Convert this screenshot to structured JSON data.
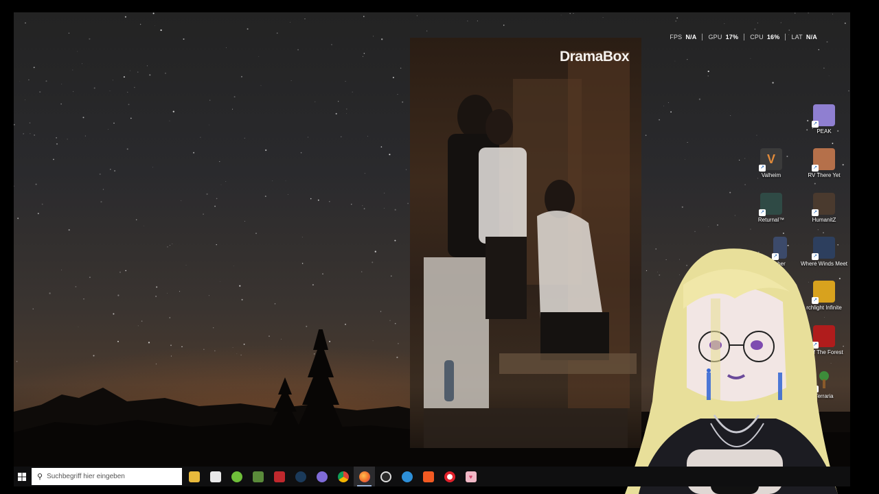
{
  "perf_overlay": {
    "items": [
      {
        "key": "FPS",
        "value": "N/A"
      },
      {
        "key": "GPU",
        "value": "17%"
      },
      {
        "key": "CPU",
        "value": "16%"
      },
      {
        "key": "LAT",
        "value": "N/A"
      }
    ]
  },
  "video_player": {
    "brand": "DramaBox"
  },
  "desktop_icons": [
    {
      "label": "PEAK",
      "icon": "peak-game-icon",
      "color": "#8f7fd1"
    },
    {
      "label": "Valheim",
      "icon": "valheim-game-icon",
      "color": "#3b3b3b"
    },
    {
      "label": "RV There Yet",
      "icon": "rv-there-yet-game-icon",
      "color": "#b5704a"
    },
    {
      "label": "Returnal™",
      "icon": "returnal-game-icon",
      "color": "#2f4a45"
    },
    {
      "label": "HumanitZ",
      "icon": "humanitz-game-icon",
      "color": "#4a3a2e"
    },
    {
      "label": "cher",
      "icon": "launcher-icon",
      "color": "#3c4a6a"
    },
    {
      "label": "Where Winds Meet",
      "icon": "where-winds-meet-game-icon",
      "color": "#2d3f5e"
    },
    {
      "label": "rchlight Infinite",
      "icon": "torchlight-infinite-game-icon",
      "color": "#d8a21e"
    },
    {
      "label": "s Of The Forest",
      "icon": "sons-of-the-forest-game-icon",
      "color": "#b01c1c"
    },
    {
      "label": "Terraria",
      "icon": "terraria-game-icon",
      "color": "#3d8c3a"
    }
  ],
  "taskbar": {
    "search_placeholder": "Suchbegriff hier eingeben",
    "apps": [
      {
        "name": "file-explorer",
        "icon": "folder-icon",
        "color": "#e8b93c",
        "letter": ""
      },
      {
        "name": "microsoft-store",
        "icon": "store-icon",
        "color": "#e9e9e9",
        "letter": ""
      },
      {
        "name": "android-app",
        "icon": "android-icon",
        "color": "#6fbf3a",
        "letter": ""
      },
      {
        "name": "minecraft",
        "icon": "minecraft-icon",
        "color": "#5a8a3a",
        "letter": ""
      },
      {
        "name": "epic-game-app",
        "icon": "game-launcher-icon",
        "color": "#c0282d",
        "letter": ""
      },
      {
        "name": "steam",
        "icon": "steam-icon",
        "color": "#1b3a5a",
        "letter": ""
      },
      {
        "name": "discord",
        "icon": "discord-icon",
        "color": "#7f6bd8",
        "letter": ""
      },
      {
        "name": "chrome",
        "icon": "chrome-icon",
        "color": "#e8b03a",
        "letter": ""
      },
      {
        "name": "firefox",
        "icon": "firefox-icon",
        "color": "#f06a2a",
        "letter": ""
      },
      {
        "name": "speedtest",
        "icon": "speedometer-icon",
        "color": "#2a2a2a",
        "letter": ""
      },
      {
        "name": "edge-like",
        "icon": "swirl-icon",
        "color": "#2d8fd8",
        "letter": ""
      },
      {
        "name": "brave",
        "icon": "brave-lion-icon",
        "color": "#f25a22",
        "letter": ""
      },
      {
        "name": "opera",
        "icon": "opera-icon",
        "color": "#e0212b",
        "letter": ""
      },
      {
        "name": "vtube-app",
        "icon": "heart-icon",
        "color": "#f1b8c6",
        "letter": ""
      }
    ]
  }
}
